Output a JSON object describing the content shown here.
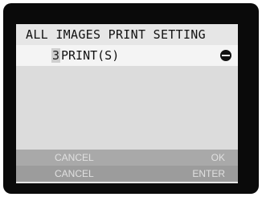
{
  "dialog": {
    "title": "ALL IMAGES PRINT SETTING",
    "print_count": "3",
    "print_unit": "PRINT(S)",
    "stepper_icon": "minus-circle-icon"
  },
  "actions": {
    "row1": {
      "left": "CANCEL",
      "right": "OK"
    },
    "row2": {
      "left": "CANCEL",
      "right": "ENTER"
    }
  },
  "colors": {
    "background": "#0a0a0a",
    "panel": "#e6e6e6",
    "button_bar": "#a9a9a9",
    "button_text": "#e0e0e0"
  }
}
